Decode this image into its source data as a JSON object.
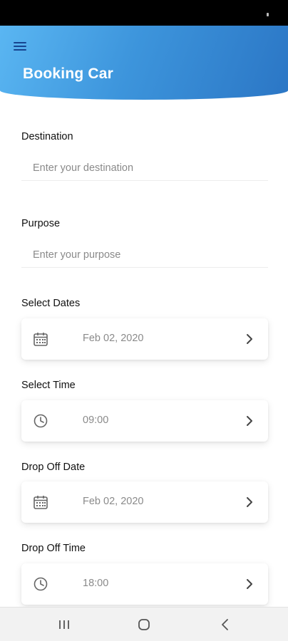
{
  "header": {
    "title": "Booking Car",
    "menu_icon": "hamburger-menu-icon"
  },
  "form": {
    "destination": {
      "label": "Destination",
      "placeholder": "Enter your destination",
      "value": ""
    },
    "purpose": {
      "label": "Purpose",
      "placeholder": "Enter your purpose",
      "value": ""
    },
    "select_dates": {
      "label": "Select Dates",
      "value": "Feb 02, 2020",
      "icon": "calendar-icon"
    },
    "select_time": {
      "label": "Select Time",
      "value": "09:00",
      "icon": "clock-icon"
    },
    "drop_off_date": {
      "label": "Drop Off Date",
      "value": "Feb 02, 2020",
      "icon": "calendar-icon"
    },
    "drop_off_time": {
      "label": "Drop Off Time",
      "value": "18:00",
      "icon": "clock-icon"
    }
  },
  "nav": {
    "icons": [
      "recent-apps-icon",
      "home-icon",
      "back-icon"
    ]
  },
  "colors": {
    "header_start": "#5ab6f2",
    "header_end": "#2b76c5",
    "menu_icon": "#17448f",
    "label": "#111111",
    "placeholder": "#8a8a8a"
  }
}
